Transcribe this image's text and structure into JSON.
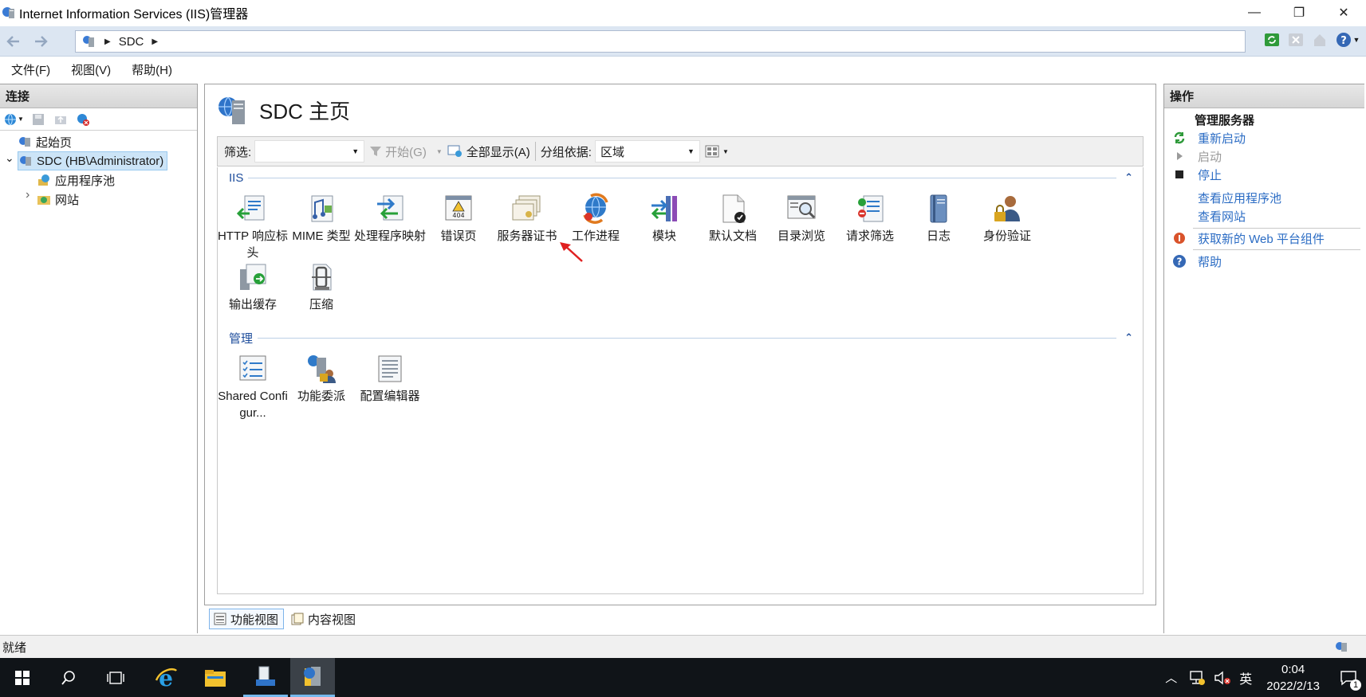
{
  "window": {
    "title": "Internet Information Services (IIS)管理器",
    "min": "—",
    "max": "❐",
    "close": "✕"
  },
  "address": {
    "crumbs": [
      "SDC"
    ]
  },
  "menu": [
    "文件(F)",
    "视图(V)",
    "帮助(H)"
  ],
  "connections": {
    "header": "连接",
    "tree": [
      {
        "label": "起始页"
      },
      {
        "label": "SDC (HB\\Administrator)",
        "expand": "⌄"
      },
      {
        "label": "应用程序池"
      },
      {
        "label": "网站",
        "expand": "›"
      }
    ]
  },
  "main": {
    "title": "SDC 主页",
    "filter": {
      "label": "筛选:",
      "value": "",
      "start": "开始(G)",
      "show_all": "全部显示(A)",
      "group_label": "分组依据:",
      "group_value": "区域"
    },
    "groups": [
      {
        "name": "IIS",
        "items": [
          {
            "label": "HTTP 响应标头",
            "icon": "http-response-headers-icon"
          },
          {
            "label": "MIME 类型",
            "icon": "mime-types-icon"
          },
          {
            "label": "处理程序映射",
            "icon": "handler-mappings-icon"
          },
          {
            "label": "错误页",
            "icon": "error-pages-icon"
          },
          {
            "label": "服务器证书",
            "icon": "server-certificates-icon"
          },
          {
            "label": "工作进程",
            "icon": "worker-processes-icon"
          },
          {
            "label": "模块",
            "icon": "modules-icon"
          },
          {
            "label": "默认文档",
            "icon": "default-document-icon"
          },
          {
            "label": "目录浏览",
            "icon": "directory-browsing-icon"
          },
          {
            "label": "请求筛选",
            "icon": "request-filtering-icon"
          },
          {
            "label": "日志",
            "icon": "logging-icon"
          },
          {
            "label": "身份验证",
            "icon": "authentication-icon"
          },
          {
            "label": "输出缓存",
            "icon": "output-caching-icon"
          },
          {
            "label": "压缩",
            "icon": "compression-icon"
          }
        ]
      },
      {
        "name": "管理",
        "items": [
          {
            "label": "Shared Configur...",
            "icon": "shared-configuration-icon"
          },
          {
            "label": "功能委派",
            "icon": "feature-delegation-icon"
          },
          {
            "label": "配置编辑器",
            "icon": "configuration-editor-icon"
          }
        ]
      }
    ],
    "view_tabs": [
      "功能视图",
      "内容视图"
    ]
  },
  "actions": {
    "header": "操作",
    "section": "管理服务器",
    "items": [
      "重新启动",
      "启动",
      "停止",
      "查看应用程序池",
      "查看网站",
      "获取新的 Web 平台组件",
      "帮助"
    ]
  },
  "status": {
    "text": "就绪"
  },
  "taskbar": {
    "lang": "英",
    "time": "0:04",
    "date": "2022/2/13",
    "notifications": "1"
  },
  "colors": {
    "link": "#2b6cc4",
    "group_header": "#1f4e9c",
    "taskbar": "#101418"
  }
}
